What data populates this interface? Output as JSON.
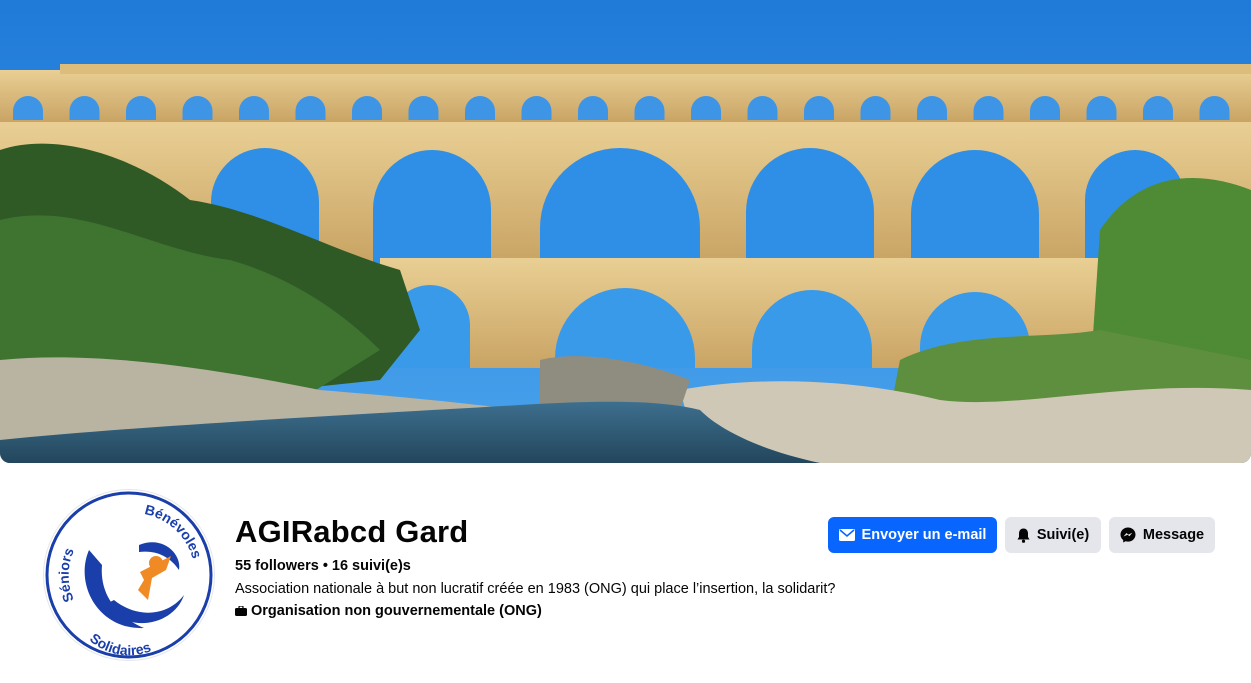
{
  "cover": {
    "image_name": "pont-du-gard-cover-photo"
  },
  "avatar": {
    "text_top_left": "Séniors",
    "text_top_right": "Bénévoles",
    "text_bottom": "Solidaires",
    "colors": {
      "ring": "#1a3faa",
      "figure": "#f08a24"
    }
  },
  "profile": {
    "name": "AGIRabcd Gard",
    "followers": "55 followers",
    "following": "16 suivi(e)s",
    "separator": "•",
    "description": "Association nationale à but non lucratif créée en 1983 (ONG) qui place l’insertion, la solidarit?",
    "category": "Organisation non gouvernementale (ONG)"
  },
  "actions": {
    "email": {
      "label": "Envoyer un e-mail",
      "icon": "envelope-icon"
    },
    "follow": {
      "label": "Suivi(e)",
      "icon": "bell-icon"
    },
    "message": {
      "label": "Message",
      "icon": "messenger-icon"
    }
  },
  "colors": {
    "primary": "#0866ff",
    "secondary_button": "#e4e6eb",
    "text": "#050505"
  }
}
